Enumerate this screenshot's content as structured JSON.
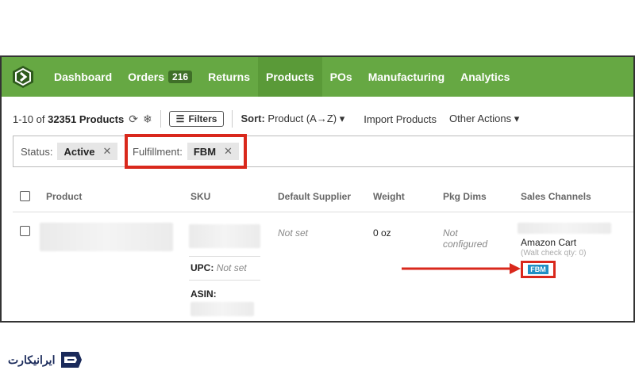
{
  "nav": {
    "items": [
      {
        "label": "Dashboard"
      },
      {
        "label": "Orders",
        "badge": "216"
      },
      {
        "label": "Returns"
      },
      {
        "label": "Products",
        "active": true
      },
      {
        "label": "POs"
      },
      {
        "label": "Manufacturing"
      },
      {
        "label": "Analytics"
      }
    ]
  },
  "toolbar": {
    "count_label": "1-10 of 32351 Products",
    "count_prefix": "1-10 of ",
    "count_value": "32351 Products",
    "filters_label": "Filters",
    "sort_label": "Sort:",
    "sort_value": "Product (A→Z)",
    "import_label": "Import Products",
    "other_actions_label": "Other Actions"
  },
  "filters": [
    {
      "name": "Status:",
      "value": "Active"
    },
    {
      "name": "Fulfillment:",
      "value": "FBM",
      "highlighted": true
    }
  ],
  "table": {
    "columns": [
      "Product",
      "SKU",
      "Default Supplier",
      "Weight",
      "Pkg Dims",
      "Sales Channels"
    ],
    "row": {
      "supplier": "Not set",
      "weight": "0 oz",
      "pkg_dims": "Not configured",
      "upc_label": "UPC:",
      "upc_value": "Not set",
      "asin_label": "ASIN:",
      "channel_name": "Amazon Cart",
      "channel_note": "(Walt check qty: 0)",
      "fulfillment_tag": "FBM"
    }
  },
  "brand": {
    "text": "ایرانیکارت"
  },
  "colors": {
    "nav_green": "#66a843",
    "highlight_red": "#d9281c",
    "fbm_blue": "#1f8fc4"
  }
}
